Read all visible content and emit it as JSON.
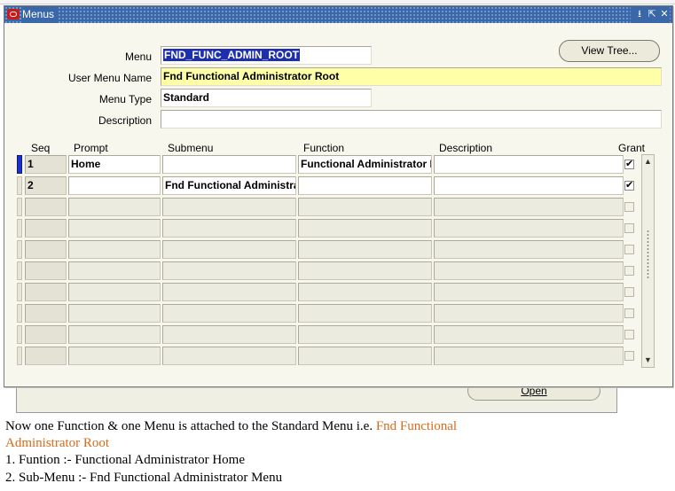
{
  "window": {
    "title": "Menus",
    "controls": [
      "minimize-icon",
      "maximize-icon",
      "close-icon"
    ]
  },
  "form": {
    "menu_label": "Menu",
    "menu_value": "FND_FUNC_ADMIN_ROOT",
    "user_menu_name_label": "User Menu Name",
    "user_menu_name_value": "Fnd Functional Administrator Root",
    "menu_type_label": "Menu Type",
    "menu_type_value": "Standard",
    "description_label": "Description",
    "description_value": "",
    "view_tree_label": "View Tree..."
  },
  "grid": {
    "headers": {
      "seq": "Seq",
      "prompt": "Prompt",
      "submenu": "Submenu",
      "function": "Function",
      "description": "Description",
      "grant": "Grant"
    },
    "rows": [
      {
        "seq": "1",
        "prompt": "Home",
        "submenu": "",
        "function": "Functional Administrator Home",
        "description": "",
        "grant": true
      },
      {
        "seq": "2",
        "prompt": "",
        "submenu": "Fnd Functional Administrator Menu",
        "function": "",
        "description": "",
        "grant": true
      },
      {
        "seq": "",
        "prompt": "",
        "submenu": "",
        "function": "",
        "description": "",
        "grant": false
      },
      {
        "seq": "",
        "prompt": "",
        "submenu": "",
        "function": "",
        "description": "",
        "grant": false
      },
      {
        "seq": "",
        "prompt": "",
        "submenu": "",
        "function": "",
        "description": "",
        "grant": false
      },
      {
        "seq": "",
        "prompt": "",
        "submenu": "",
        "function": "",
        "description": "",
        "grant": false
      },
      {
        "seq": "",
        "prompt": "",
        "submenu": "",
        "function": "",
        "description": "",
        "grant": false
      },
      {
        "seq": "",
        "prompt": "",
        "submenu": "",
        "function": "",
        "description": "",
        "grant": false
      },
      {
        "seq": "",
        "prompt": "",
        "submenu": "",
        "function": "",
        "description": "",
        "grant": false
      },
      {
        "seq": "",
        "prompt": "",
        "submenu": "",
        "function": "",
        "description": "",
        "grant": false
      }
    ]
  },
  "background_window": {
    "open_button_label": "Open"
  },
  "caption": {
    "line1_prefix": "Now one Function & one Menu is attached to the Standard Menu i.e. ",
    "line1_highlight": "Fnd Functional",
    "line2_highlight": "Administrator Root",
    "item1": "1. Funtion :- Functional Administrator Home",
    "item2": "2. Sub-Menu :- Fnd Functional Administrator Menu"
  },
  "colors": {
    "titlebar": "#3a67a8",
    "window_bg": "#f7f7ee",
    "required_field": "#ffffa8",
    "selection": "#1d2fb0",
    "caption_highlight": "#d76b1a"
  }
}
